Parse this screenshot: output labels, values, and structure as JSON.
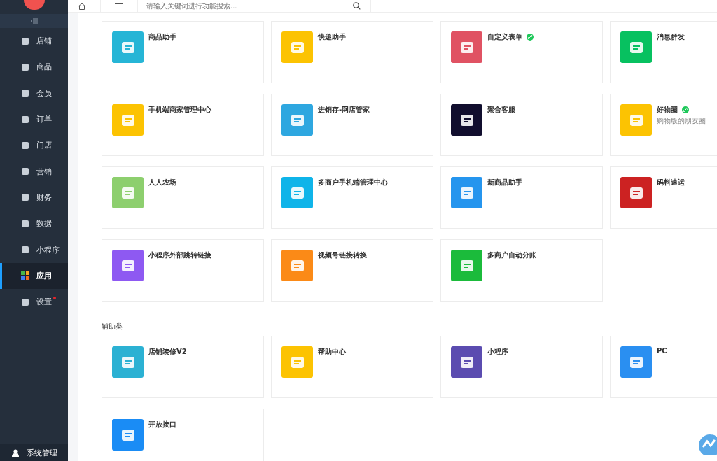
{
  "search": {
    "placeholder": "请输入关键词进行功能搜索..."
  },
  "sidebar": {
    "items": [
      {
        "label": "店铺",
        "selected": false,
        "badge_dot": false
      },
      {
        "label": "商品",
        "selected": false,
        "badge_dot": false
      },
      {
        "label": "会员",
        "selected": false,
        "badge_dot": false
      },
      {
        "label": "订单",
        "selected": false,
        "badge_dot": false
      },
      {
        "label": "门店",
        "selected": false,
        "badge_dot": false
      },
      {
        "label": "营销",
        "selected": false,
        "badge_dot": false
      },
      {
        "label": "财务",
        "selected": false,
        "badge_dot": false
      },
      {
        "label": "数据",
        "selected": false,
        "badge_dot": false
      },
      {
        "label": "小程序",
        "selected": false,
        "badge_dot": false
      },
      {
        "label": "应用",
        "selected": true,
        "badge_dot": false
      },
      {
        "label": "设置",
        "selected": false,
        "badge_dot": true
      }
    ],
    "footer": "系统管理"
  },
  "sections": [
    {
      "apps": [
        {
          "name": "商品助手",
          "color": "#26b5d6",
          "link_badge": false
        },
        {
          "name": "快递助手",
          "color": "#fcc302",
          "link_badge": false
        },
        {
          "name": "自定义表单",
          "color": "#e05263",
          "link_badge": true
        },
        {
          "name": "消息群发",
          "color": "#07c160",
          "link_badge": false
        },
        {
          "name": "手机端商家管理中心",
          "color": "#fcc302",
          "link_badge": false
        },
        {
          "name": "进销存-网店管家",
          "color": "#2ea7e0",
          "link_badge": false
        },
        {
          "name": "聚合客服",
          "color": "#110e2e",
          "link_badge": false
        },
        {
          "name": "好物圈",
          "color": "#fcc302",
          "link_badge": true,
          "subtitle": "购物版的朋友圈"
        },
        {
          "name": "人人农场",
          "color": "#8dcf6e",
          "link_badge": false
        },
        {
          "name": "多商户手机端管理中心",
          "color": "#0fb4e9",
          "link_badge": false
        },
        {
          "name": "新商品助手",
          "color": "#2595ee",
          "link_badge": false
        },
        {
          "name": "码料速运",
          "color": "#cc2222",
          "link_badge": false
        },
        {
          "name": "小程序外部跳转链接",
          "color": "#8e59f2",
          "link_badge": false
        },
        {
          "name": "视频号链接转换",
          "color": "#fb8a17",
          "link_badge": false
        },
        {
          "name": "多商户自动分账",
          "color": "#1bbb3b",
          "link_badge": false
        }
      ]
    },
    {
      "title": "辅助类",
      "apps": [
        {
          "name": "店铺装修V2",
          "color": "#2bb1d3",
          "link_badge": false
        },
        {
          "name": "帮助中心",
          "color": "#fcc302",
          "link_badge": false
        },
        {
          "name": "小程序",
          "color": "#5b4cb0",
          "link_badge": false
        },
        {
          "name": "PC",
          "color": "#2a8ff1",
          "link_badge": false
        },
        {
          "name": "开放接口",
          "color": "#1a8cf5",
          "link_badge": false
        }
      ]
    }
  ]
}
